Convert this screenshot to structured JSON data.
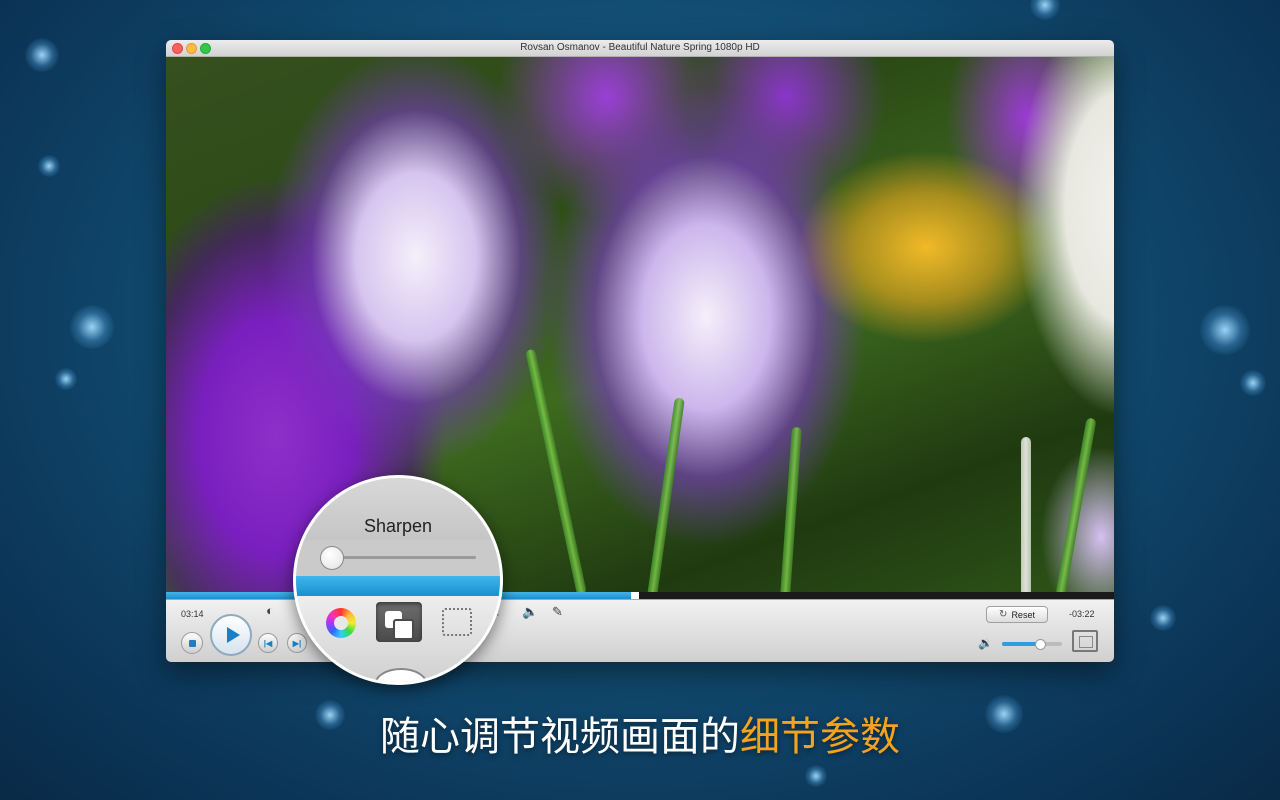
{
  "window": {
    "title": "Rovsan Osmanov - Beautiful Nature Spring 1080p HD"
  },
  "player": {
    "elapsed": "03:14",
    "remaining": "-03:22",
    "progress_fraction": 0.49,
    "volume_fraction": 0.62,
    "reset_label": "Reset",
    "icons": [
      "contrast-icon",
      "equalizer-icon",
      "audio-icon",
      "subtitle-icon",
      "volume-icon",
      "fullscreen-icon"
    ]
  },
  "magnifier": {
    "title": "Sharpen",
    "slider_fraction": 0.0,
    "icons": [
      "color-wheel-icon",
      "sharpen-icon",
      "crop-icon"
    ]
  },
  "caption": {
    "normal": "随心调节视频画面的",
    "highlight": "细节参数"
  },
  "colors": {
    "accent": "#1b8fd0",
    "caption_highlight": "#f5a21e"
  }
}
